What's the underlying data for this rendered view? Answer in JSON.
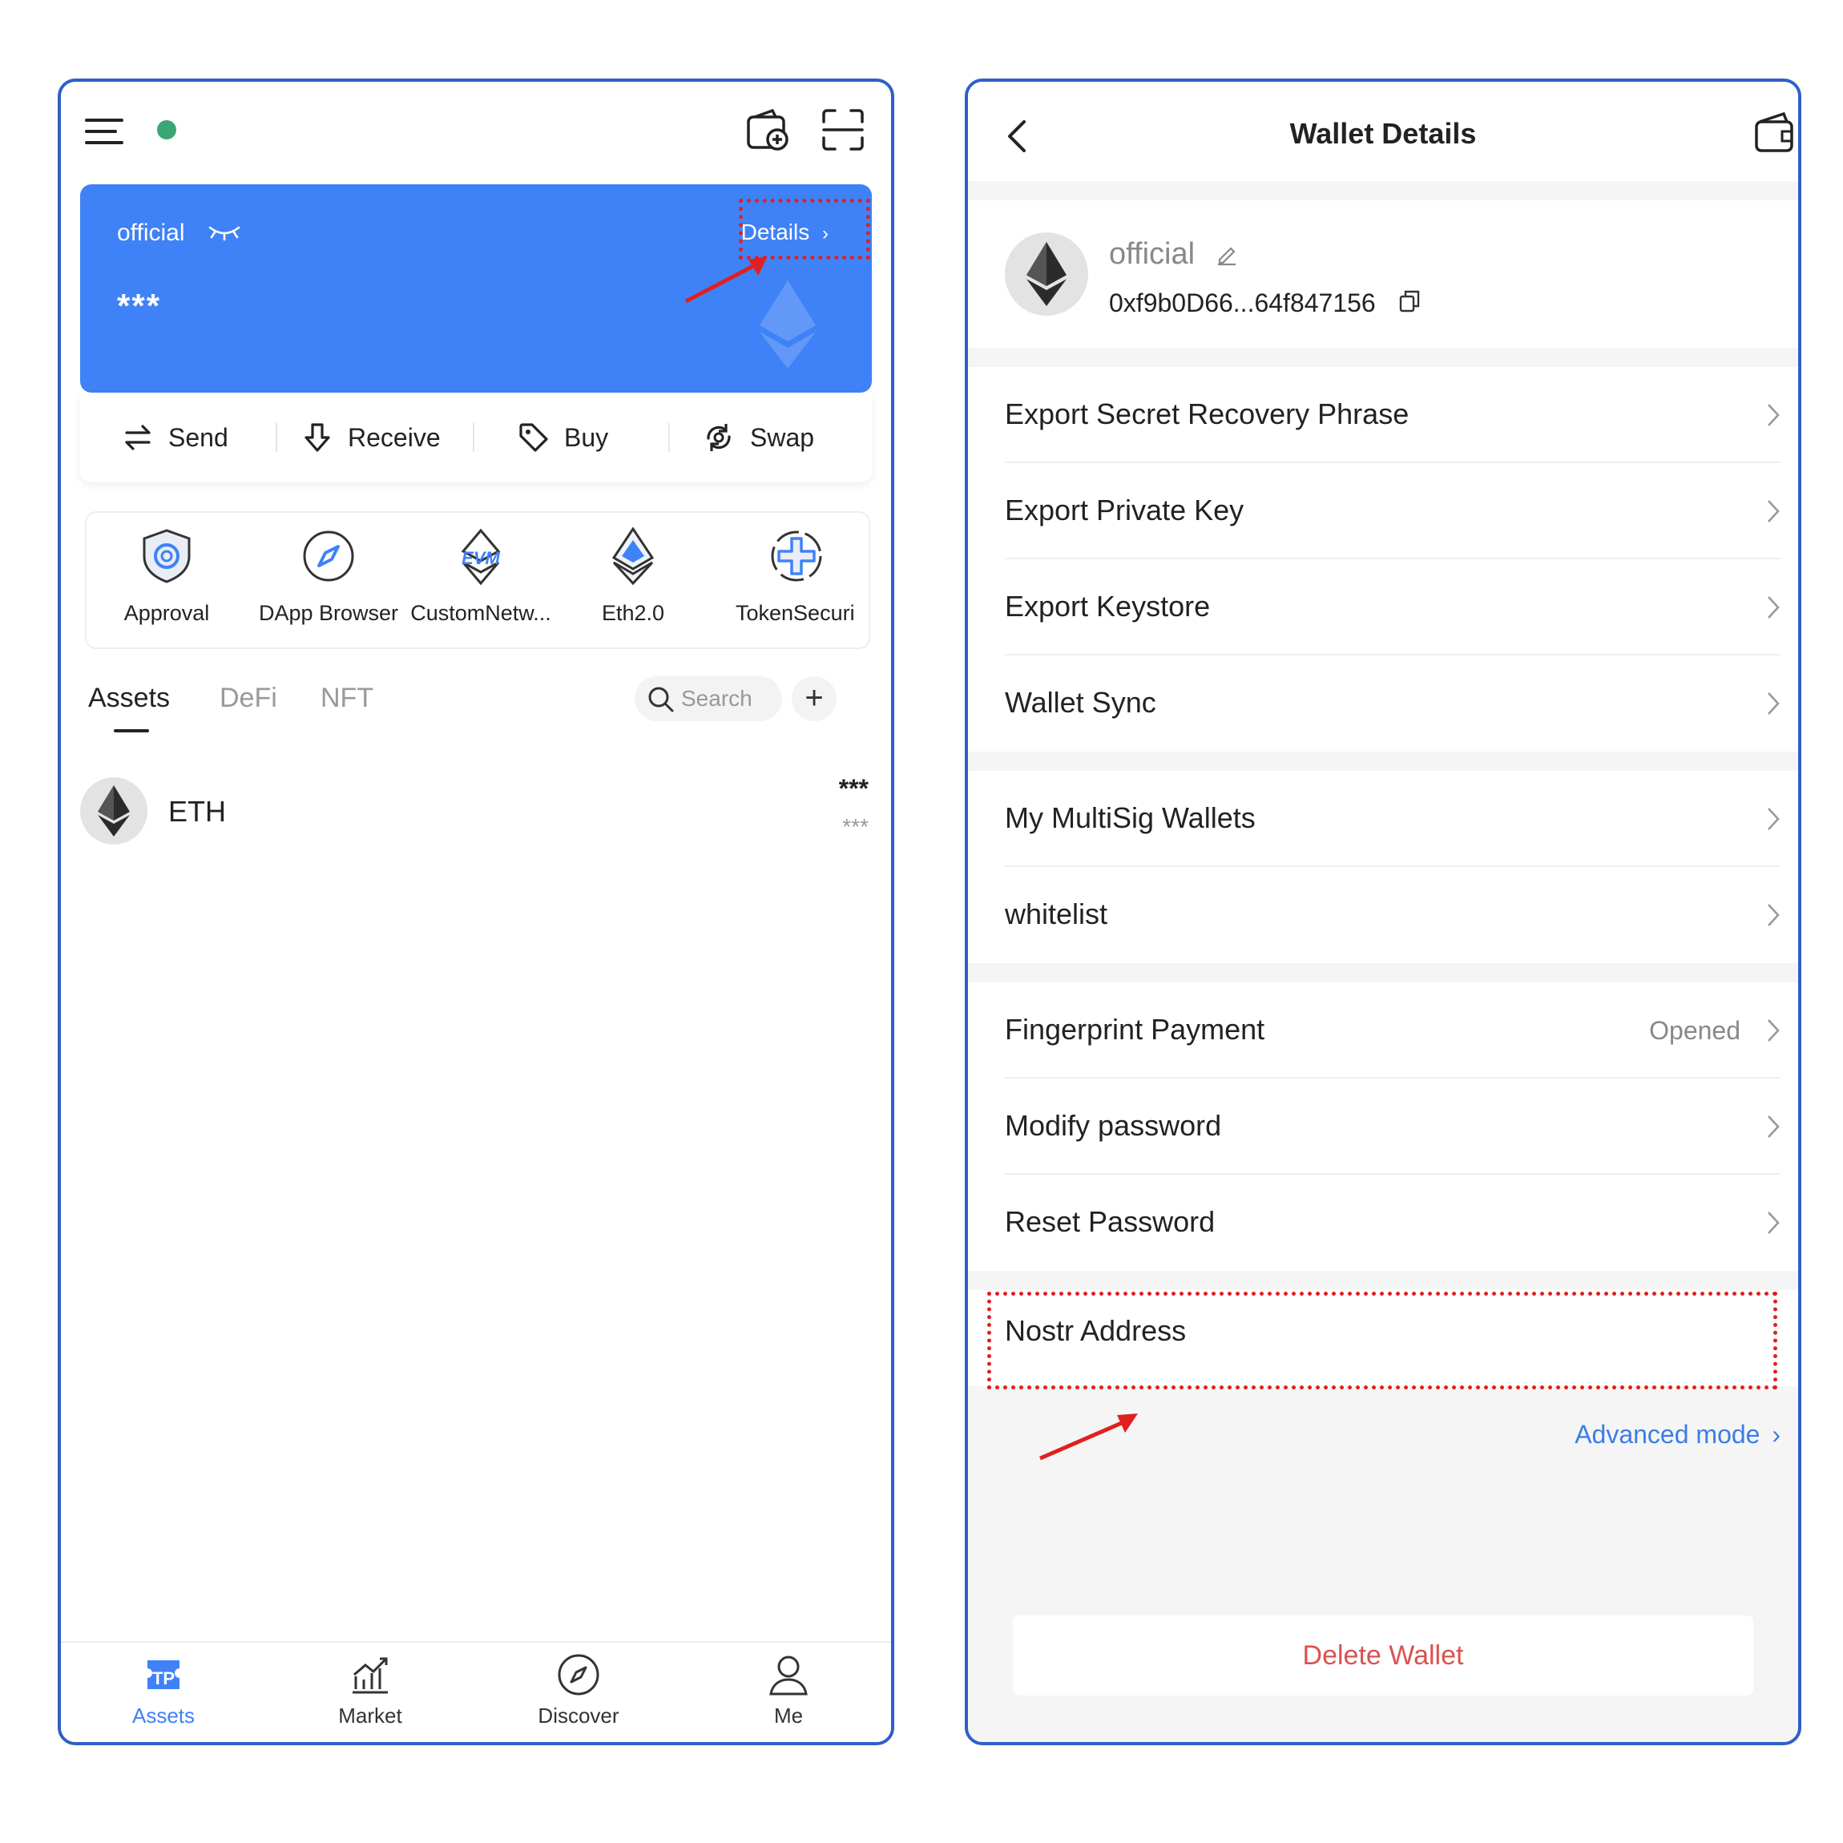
{
  "colors": {
    "accent": "#3f82f7",
    "frame": "#2f5fc7",
    "annotation": "#e02020",
    "danger": "#d9534f",
    "online": "#3aa673",
    "link": "#3a7ee8"
  },
  "left": {
    "wallet": {
      "name": "official",
      "balance": "***",
      "details_label": "Details"
    },
    "actions": [
      {
        "label": "Send",
        "icon": "swap-arrows-icon"
      },
      {
        "label": "Receive",
        "icon": "download-icon"
      },
      {
        "label": "Buy",
        "icon": "tag-icon"
      },
      {
        "label": "Swap",
        "icon": "swap-cycle-icon"
      }
    ],
    "dapps": [
      {
        "label": "Approval",
        "icon": "shield-icon"
      },
      {
        "label": "DApp Browser",
        "icon": "compass-icon"
      },
      {
        "label": "CustomNetw...",
        "icon": "evm-icon"
      },
      {
        "label": "Eth2.0",
        "icon": "ethereum-icon"
      },
      {
        "label": "TokenSecuri",
        "icon": "token-security-icon"
      }
    ],
    "tabs": [
      {
        "label": "Assets"
      },
      {
        "label": "DeFi"
      },
      {
        "label": "NFT"
      }
    ],
    "search_placeholder": "Search",
    "tokens": [
      {
        "symbol": "ETH",
        "amount": "***",
        "value": "***"
      }
    ],
    "nav": [
      {
        "label": "Assets",
        "icon": "tp-icon"
      },
      {
        "label": "Market",
        "icon": "chart-icon"
      },
      {
        "label": "Discover",
        "icon": "compass-icon"
      },
      {
        "label": "Me",
        "icon": "user-icon"
      }
    ]
  },
  "right": {
    "title": "Wallet Details",
    "wallet": {
      "name": "official",
      "address": "0xf9b0D66...64f847156"
    },
    "sections": [
      {
        "rows": [
          {
            "label": "Export Secret Recovery Phrase"
          },
          {
            "label": "Export Private Key"
          },
          {
            "label": "Export Keystore"
          },
          {
            "label": "Wallet Sync"
          }
        ]
      },
      {
        "rows": [
          {
            "label": "My MultiSig Wallets"
          },
          {
            "label": "whitelist"
          }
        ]
      },
      {
        "rows": [
          {
            "label": "Fingerprint Payment",
            "value": "Opened"
          },
          {
            "label": "Modify password"
          },
          {
            "label": "Reset Password"
          }
        ]
      },
      {
        "rows": [
          {
            "label": "Nostr Address"
          }
        ]
      }
    ],
    "advanced_mode": "Advanced mode",
    "delete_label": "Delete Wallet"
  }
}
